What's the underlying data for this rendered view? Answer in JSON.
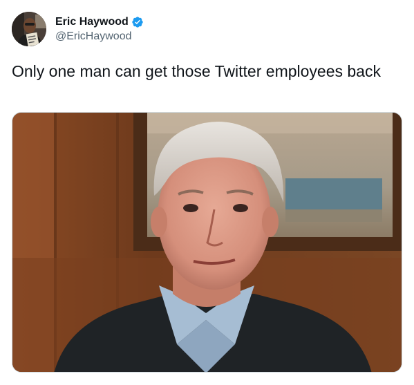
{
  "author": {
    "display_name": "Eric Haywood",
    "handle": "@EricHaywood",
    "verified": true,
    "avatar_icon": "profile-photo"
  },
  "tweet": {
    "text": "Only one man can get those Twitter employees back"
  },
  "media": {
    "type": "photo",
    "icon": "photo-portrait"
  },
  "colors": {
    "verified_badge": "#1d9bf0",
    "handle_text": "#536471",
    "primary_text": "#0f1419"
  }
}
